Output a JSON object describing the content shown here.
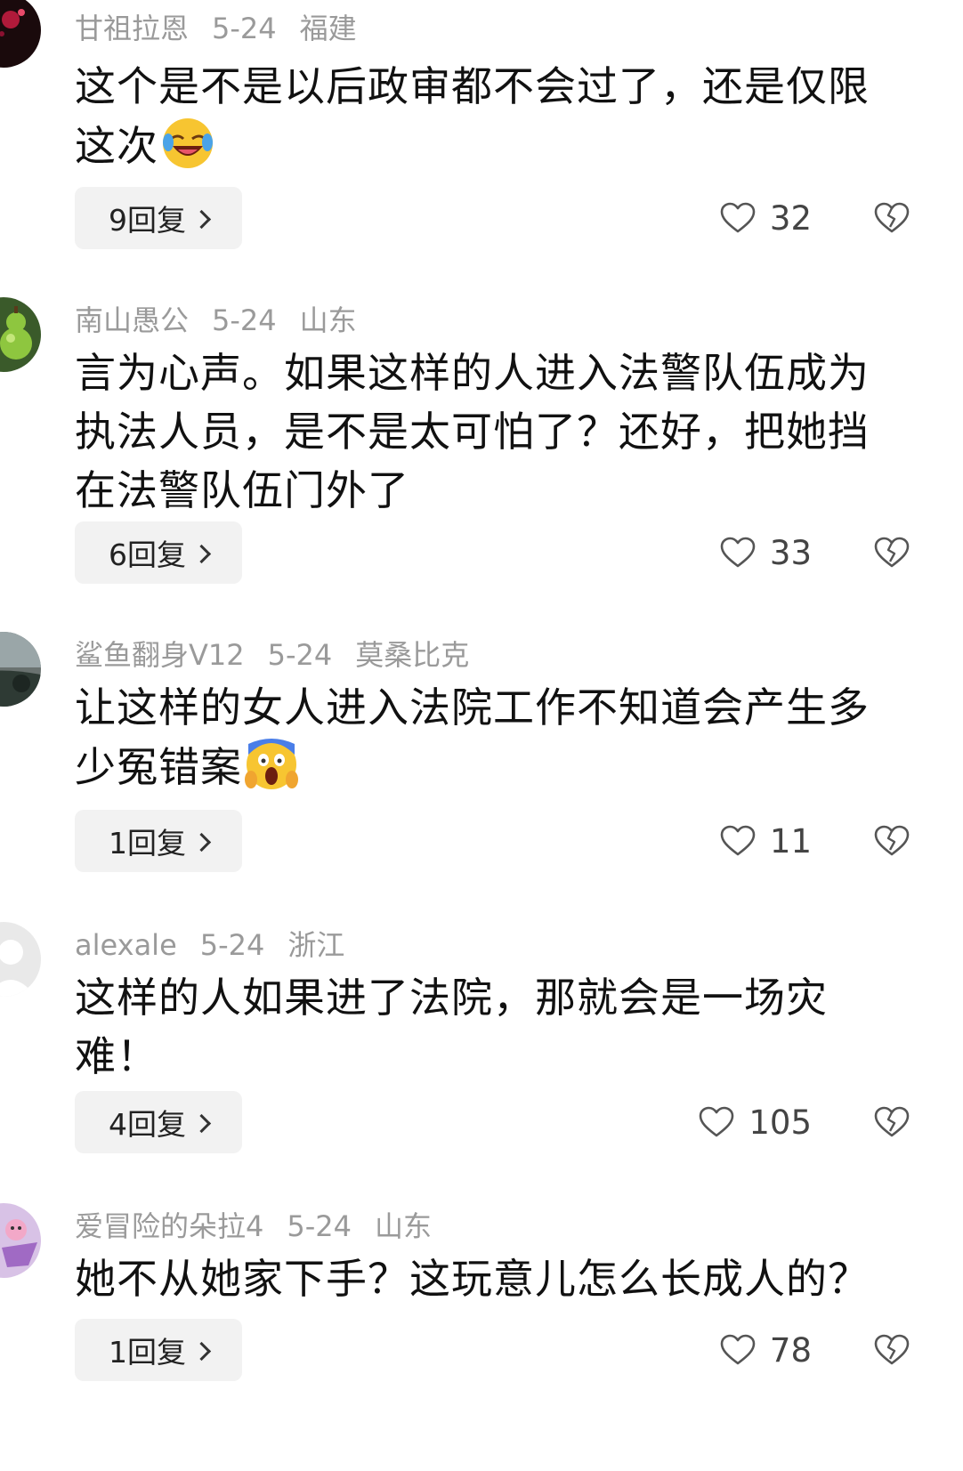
{
  "comments": [
    {
      "username": "甘祖拉恩",
      "date": "5-24",
      "location": "福建",
      "text": "这个是不是以后政审都不会过了，还是仅限这次",
      "emoji": "laughing-emoji",
      "reply_label": "9回复",
      "likes": "32",
      "avatar": "avatar-dark-red"
    },
    {
      "username": "南山愚公",
      "date": "5-24",
      "location": "山东",
      "text": "言为心声。如果这样的人进入法警队伍成为执法人员，是不是太可怕了？还好，把她挡在法警队伍门外了",
      "reply_label": "6回复",
      "likes": "33",
      "avatar": "avatar-green-gourd"
    },
    {
      "username": "鲨鱼翻身V12",
      "date": "5-24",
      "location": "莫桑比克",
      "text": "让这样的女人进入法院工作不知道会产生多少冤错案",
      "emoji": "screaming-emoji",
      "reply_label": "1回复",
      "likes": "11",
      "avatar": "avatar-landscape"
    },
    {
      "username": "alexale",
      "date": "5-24",
      "location": "浙江",
      "text": "这样的人如果进了法院，那就会是一场灾难！",
      "reply_label": "4回复",
      "likes": "105",
      "avatar": "avatar-default-grey"
    },
    {
      "username": "爱冒险的朵拉4",
      "date": "5-24",
      "location": "山东",
      "text": "她不从她家下手？这玩意儿怎么长成人的？",
      "reply_label": "1回复",
      "likes": "78",
      "avatar": "avatar-cartoon"
    }
  ],
  "colors": {
    "meta": "#9a9a9a",
    "reply_bg": "#f2f2f2",
    "text": "#111111"
  }
}
